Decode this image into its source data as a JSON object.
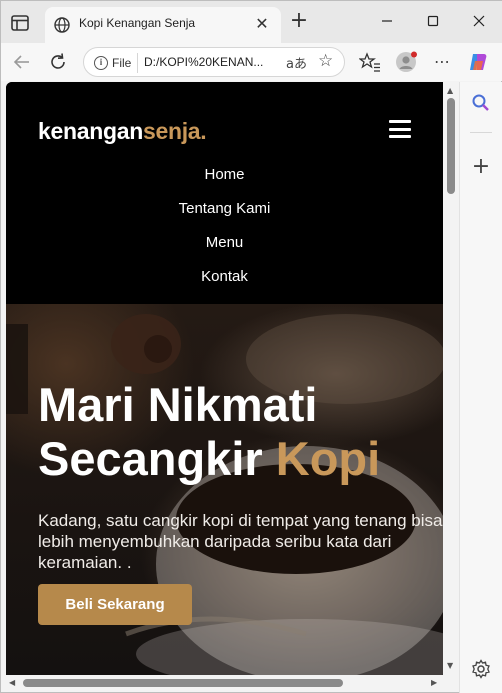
{
  "browser": {
    "tab": {
      "title": "Kopi Kenangan Senja",
      "close": "✕"
    },
    "address": {
      "file_chip": "File",
      "url": "D:/KOPI%20KENAN...",
      "read_aloud": "aあ"
    }
  },
  "page": {
    "logo": {
      "part1": "kenangan",
      "part2": "senja."
    },
    "nav": [
      "Home",
      "Tentang Kami",
      "Menu",
      "Kontak"
    ],
    "hero": {
      "title_line1": "Mari Nikmati",
      "title_line2": "Secangkir",
      "title_accent": "Kopi",
      "description": "Kadang, satu cangkir kopi di tempat yang tenang bisa lebih menyembuhkan daripada seribu kata dari keramaian. .",
      "button": "Beli Sekarang"
    }
  },
  "colors": {
    "accent": "#c9985a",
    "button": "#b6894b",
    "nav_bg": "#000000"
  },
  "icons": [
    "tab-actions-icon",
    "globe-icon",
    "new-tab-icon",
    "minimize-icon",
    "maximize-icon",
    "close-window-icon",
    "back-icon",
    "reload-icon",
    "info-icon",
    "favorites-icon",
    "collections-icon",
    "profile-icon",
    "more-icon",
    "copilot-icon",
    "search-sidebar-icon",
    "add-sidebar-icon",
    "settings-icon",
    "hamburger-icon"
  ]
}
